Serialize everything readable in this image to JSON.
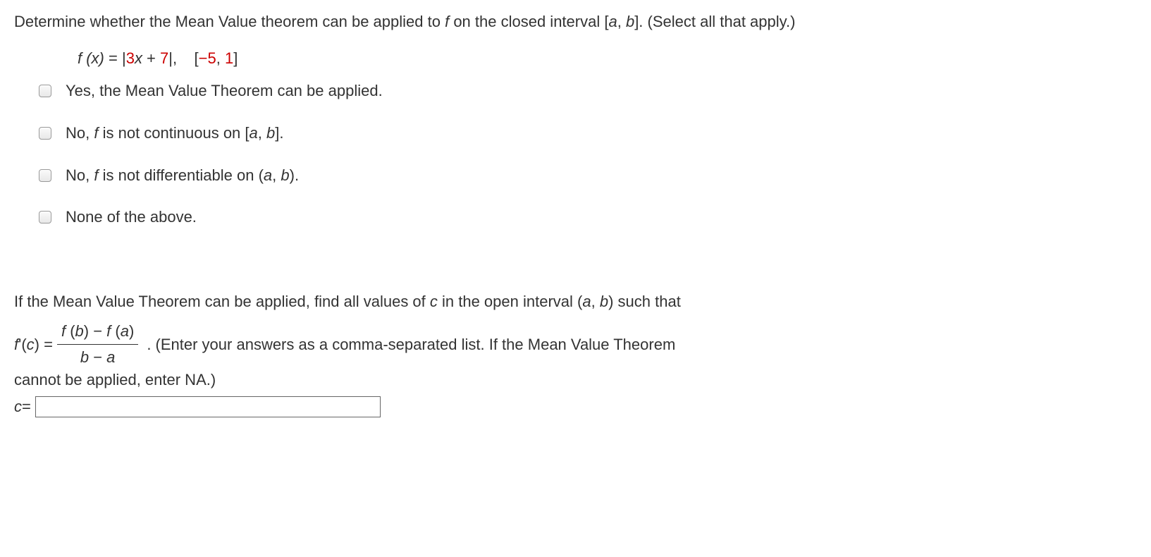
{
  "question": {
    "prompt_part1": "Determine whether the Mean Value theorem can be applied to ",
    "prompt_var_f": "f",
    "prompt_part2": " on the closed interval [",
    "prompt_var_a": "a",
    "prompt_comma": ", ",
    "prompt_var_b": "b",
    "prompt_part3": "]. (Select all that apply.)"
  },
  "function": {
    "lhs": "f (x) ",
    "equals": "= |",
    "coef3": "3",
    "var_x": "x",
    "plus": " + ",
    "coef7": "7",
    "abs_close": "|,",
    "spacer": "    ",
    "interval_open": "[",
    "interval_neg5": "−5",
    "interval_comma": ", ",
    "interval_1": "1",
    "interval_close": "]"
  },
  "options": [
    {
      "text": "Yes, the Mean Value Theorem can be applied."
    },
    {
      "text_pre": "No, ",
      "text_var": "f",
      "text_mid": " is not continuous on [",
      "text_a": "a",
      "text_comma": ", ",
      "text_b": "b",
      "text_end": "]."
    },
    {
      "text_pre": "No, ",
      "text_var": "f",
      "text_mid": " is not differentiable on (",
      "text_a": "a",
      "text_comma": ", ",
      "text_b": "b",
      "text_end": ")."
    },
    {
      "text": "None of the above."
    }
  ],
  "second_question": {
    "part1": "If the Mean Value Theorem can be applied, find all values of ",
    "var_c": "c",
    "part2": " in the open interval (",
    "var_a": "a",
    "comma": ", ",
    "var_b": "b",
    "part3": ") such that "
  },
  "formula": {
    "lhs_f": "f ",
    "lhs_prime": "'(",
    "lhs_c": "c",
    "lhs_close": ") = ",
    "num_f": "f ",
    "num_open": "(",
    "num_b": "b",
    "num_close": ")",
    "num_minus": " − ",
    "num_f2": "f ",
    "num_open2": "(",
    "num_a": "a",
    "num_close2": ")",
    "den_b": "b",
    "den_minus": " − ",
    "den_a": "a",
    "trail": " . (Enter your answers as a comma-separated list. If the Mean Value Theorem"
  },
  "formula_line2": "cannot be applied, enter NA.)",
  "answer": {
    "label_c": "c",
    "label_eq": " = "
  }
}
